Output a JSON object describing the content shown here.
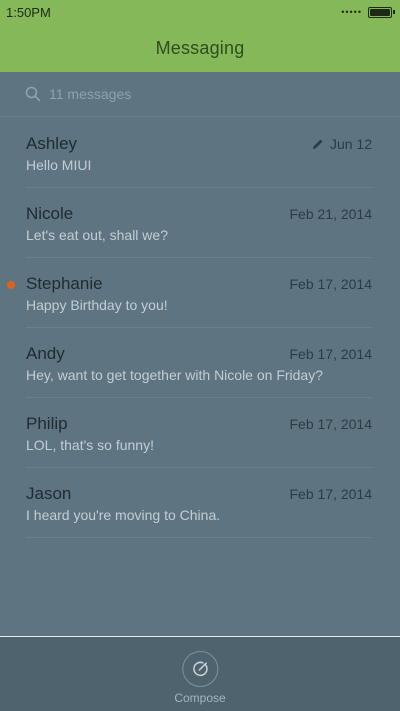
{
  "status_bar": {
    "time": "1:50PM",
    "signal_dots": "•••••",
    "battery_level": 1.0
  },
  "header": {
    "title": "Messaging"
  },
  "search": {
    "placeholder": "11 messages"
  },
  "conversations": [
    {
      "name": "Ashley",
      "preview": "Hello MIUI",
      "date": "Jun 12",
      "draft": true,
      "unread": false
    },
    {
      "name": "Nicole",
      "preview": "Let's eat out, shall we?",
      "date": "Feb 21, 2014",
      "draft": false,
      "unread": false
    },
    {
      "name": "Stephanie",
      "preview": "Happy Birthday to you!",
      "date": "Feb 17, 2014",
      "draft": false,
      "unread": true
    },
    {
      "name": "Andy",
      "preview": "Hey, want to get together with Nicole on Friday?",
      "date": "Feb 17, 2014",
      "draft": false,
      "unread": false
    },
    {
      "name": "Philip",
      "preview": "LOL, that's so funny!",
      "date": "Feb 17, 2014",
      "draft": false,
      "unread": false
    },
    {
      "name": "Jason",
      "preview": "I heard you're moving to China.",
      "date": "Feb 17, 2014",
      "draft": false,
      "unread": false
    }
  ],
  "bottom_bar": {
    "compose_label": "Compose",
    "compose_icon": "compose-icon"
  },
  "colors": {
    "accent": "#84b859",
    "unread": "#e0601f",
    "background": "#5e7480"
  }
}
